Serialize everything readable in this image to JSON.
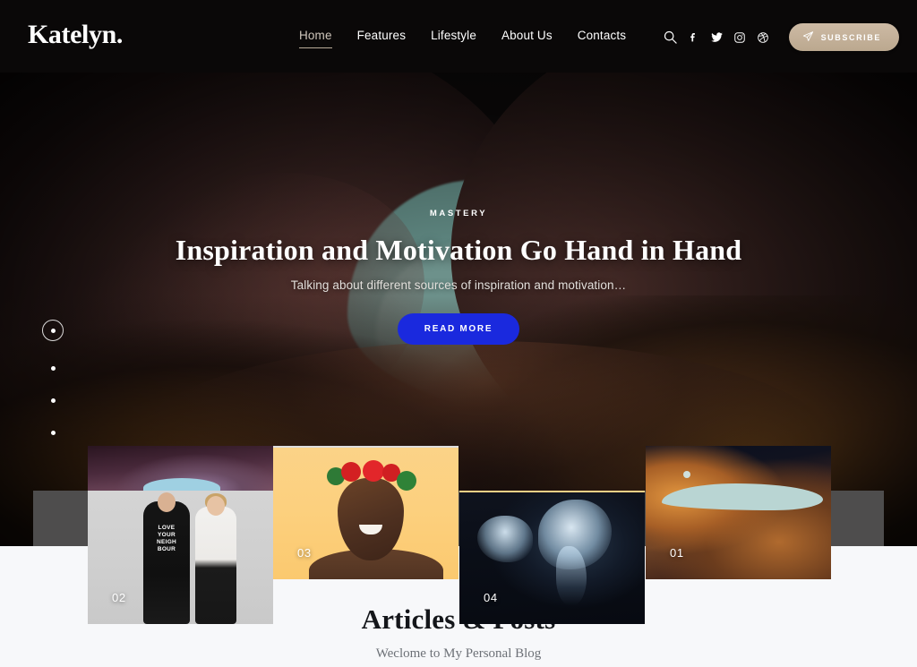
{
  "header": {
    "logo": "Katelyn.",
    "nav": [
      {
        "label": "Home",
        "active": true
      },
      {
        "label": "Features",
        "active": false
      },
      {
        "label": "Lifestyle",
        "active": false
      },
      {
        "label": "About Us",
        "active": false
      },
      {
        "label": "Contacts",
        "active": false
      }
    ],
    "tools": [
      {
        "icon": "search-icon"
      },
      {
        "icon": "facebook-icon"
      },
      {
        "icon": "twitter-icon"
      },
      {
        "icon": "instagram-icon"
      },
      {
        "icon": "dribbble-icon"
      }
    ],
    "subscribe": {
      "label": "SUBSCRIBE",
      "icon": "paper-plane-icon",
      "bg_color": "#c4ad95"
    },
    "bg_color": "#0a0808"
  },
  "hero": {
    "category": "MASTERY",
    "title": "Inspiration and Motivation Go Hand in Hand",
    "subtitle": "Talking about different sources of inspiration and motivation…",
    "cta_label": "READ MORE",
    "cta_color": "#1a29de",
    "slider_dots": [
      {
        "index": 1,
        "active": true
      },
      {
        "index": 2,
        "active": false
      },
      {
        "index": 3,
        "active": false
      },
      {
        "index": 4,
        "active": false
      }
    ]
  },
  "thumbnails": [
    {
      "number": "02",
      "alt": "couple in studio wearing love your neighbour sweatshirt"
    },
    {
      "number": "03",
      "alt": "smiling woman with red flower crown on yellow"
    },
    {
      "number": "04",
      "alt": "blue jellyfish on dark background"
    },
    {
      "number": "01",
      "alt": "orange slot canyon with teal sky"
    }
  ],
  "articles": {
    "title": "Articles & Posts",
    "subtitle": "Weclome to My Personal Blog",
    "bg_color": "#f7f8fa"
  }
}
